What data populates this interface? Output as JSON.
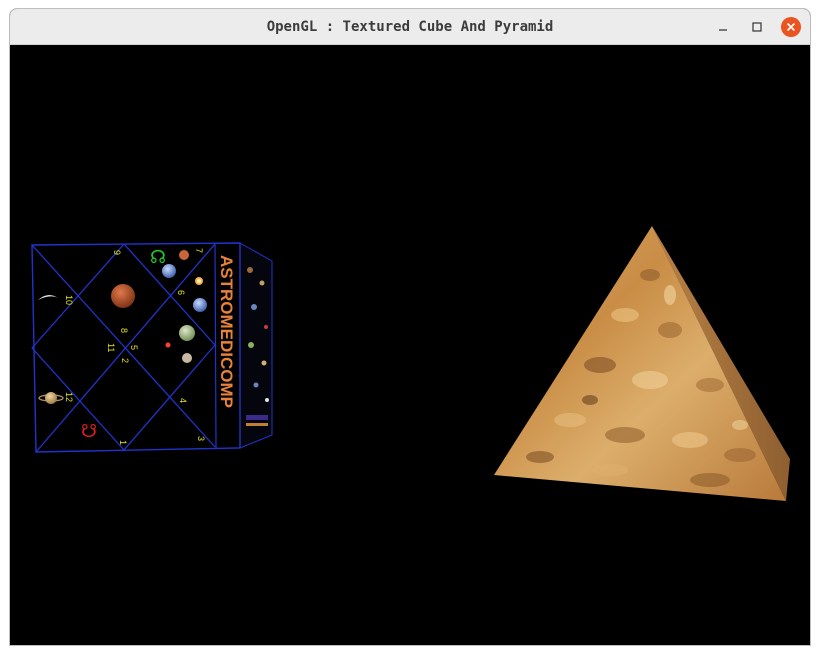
{
  "window": {
    "title": "OpenGL : Textured Cube And Pyramid",
    "minimize_icon": "minimize-icon",
    "maximize_icon": "maximize-icon",
    "close_icon": "close-icon",
    "close_color": "#e95420"
  },
  "scene": {
    "background": "#000000",
    "cube": {
      "side_text": "ASTROMEDICOMP",
      "side_text_color": "#e8823a",
      "grid_color": "#2233cc",
      "house_numbers": [
        "9",
        "7",
        "6",
        "10",
        "8",
        "5",
        "11",
        "2",
        "12",
        "4",
        "1",
        "3"
      ],
      "node_symbol_top": "☊",
      "node_symbol_bottom": "☋",
      "node_top_color": "#22cc22",
      "node_bottom_color": "#e02020"
    },
    "pyramid": {
      "texture": "sandstone",
      "base_color": "#c8904a"
    }
  }
}
